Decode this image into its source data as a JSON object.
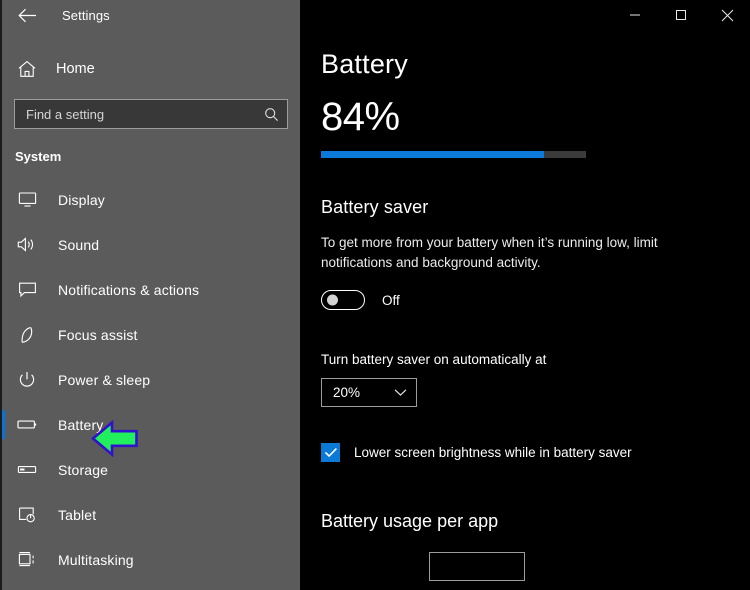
{
  "window": {
    "title": "Settings",
    "back_icon": "back-arrow-icon",
    "controls": [
      {
        "name": "minimize-button",
        "glyph": "minimize-icon",
        "label": "Minimize"
      },
      {
        "name": "maximize-button",
        "glyph": "maximize-icon",
        "label": "Maximize"
      },
      {
        "name": "close-button",
        "glyph": "close-icon",
        "label": "Close"
      }
    ]
  },
  "sidebar": {
    "home": {
      "label": "Home",
      "icon": "home-icon"
    },
    "search": {
      "placeholder": "Find a setting",
      "value": "",
      "icon": "search-icon"
    },
    "group_header": "System",
    "selected_index": 5,
    "accent_color": "#0a74d6",
    "items": [
      {
        "label": "Display",
        "icon": "monitor-icon"
      },
      {
        "label": "Sound",
        "icon": "speaker-icon"
      },
      {
        "label": "Notifications & actions",
        "icon": "chat-bubble-icon"
      },
      {
        "label": "Focus assist",
        "icon": "moon-icon"
      },
      {
        "label": "Power & sleep",
        "icon": "power-icon"
      },
      {
        "label": "Battery",
        "icon": "battery-icon"
      },
      {
        "label": "Storage",
        "icon": "storage-icon"
      },
      {
        "label": "Tablet",
        "icon": "tablet-icon"
      },
      {
        "label": "Multitasking",
        "icon": "multitasking-icon"
      }
    ]
  },
  "main": {
    "page_title": "Battery",
    "battery": {
      "percent_label": "84%",
      "percent_value": 84,
      "fill_color": "#0b7ad8",
      "track_color": "#3b3b3b"
    },
    "battery_saver": {
      "heading": "Battery saver",
      "description": "To get more from your battery when it’s running low, limit notifications and background activity.",
      "toggle_state": "Off",
      "toggle_on": false
    },
    "auto_on": {
      "label": "Turn battery saver on automatically at",
      "selected": "20%",
      "chevron_icon": "chevron-down-icon"
    },
    "lower_brightness": {
      "label": "Lower screen brightness while in battery saver",
      "checked": true,
      "check_color": "#0a7ad6",
      "icon": "checkmark-icon"
    },
    "usage_heading": "Battery usage per app"
  },
  "annotation": {
    "arrow": {
      "icon": "left-arrow-annotation-icon",
      "fill_color": "#22ef5e",
      "stroke_color": "#3311cc",
      "points_at": "Battery"
    }
  }
}
